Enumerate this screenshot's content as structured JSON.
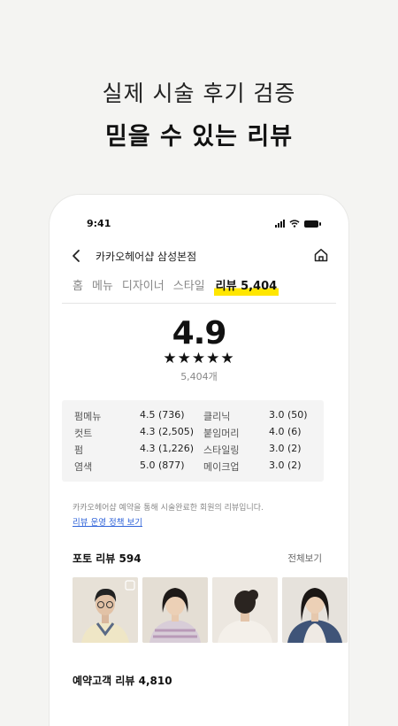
{
  "headline": {
    "sub": "실제 시술 후기 검증",
    "main": "믿을 수 있는 리뷰"
  },
  "status": {
    "time": "9:41"
  },
  "topbar": {
    "title": "카카오헤어샵 삼성본점"
  },
  "tabs": [
    {
      "label": "홈"
    },
    {
      "label": "메뉴"
    },
    {
      "label": "디자이너"
    },
    {
      "label": "스타일"
    },
    {
      "label": "리뷰 5,404",
      "active": true
    }
  ],
  "rating": {
    "score": "4.9",
    "stars": "★★★★★",
    "count": "5,404개"
  },
  "stats": [
    {
      "label": "펌메뉴",
      "value": "4.5 (736)"
    },
    {
      "label": "컷트",
      "value": "4.3 (2,505)"
    },
    {
      "label": "펌",
      "value": "4.3 (1,226)"
    },
    {
      "label": "염색",
      "value": "5.0 (877)"
    },
    {
      "label": "클리닉",
      "value": "3.0 (50)"
    },
    {
      "label": "붙임머리",
      "value": "4.0 (6)"
    },
    {
      "label": "스타일링",
      "value": "3.0 (2)"
    },
    {
      "label": "메이크업",
      "value": "3.0 (2)"
    }
  ],
  "notice": {
    "text": "카카오헤어샵 예약을 통해 시술완료한 회원의 리뷰입니다.",
    "link": "리뷰 운영 정책 보기"
  },
  "photo_reviews": {
    "title": "포토 리뷰 594",
    "see_all": "전체보기"
  },
  "booking_reviews": {
    "title": "예약고객 리뷰 4,810"
  }
}
